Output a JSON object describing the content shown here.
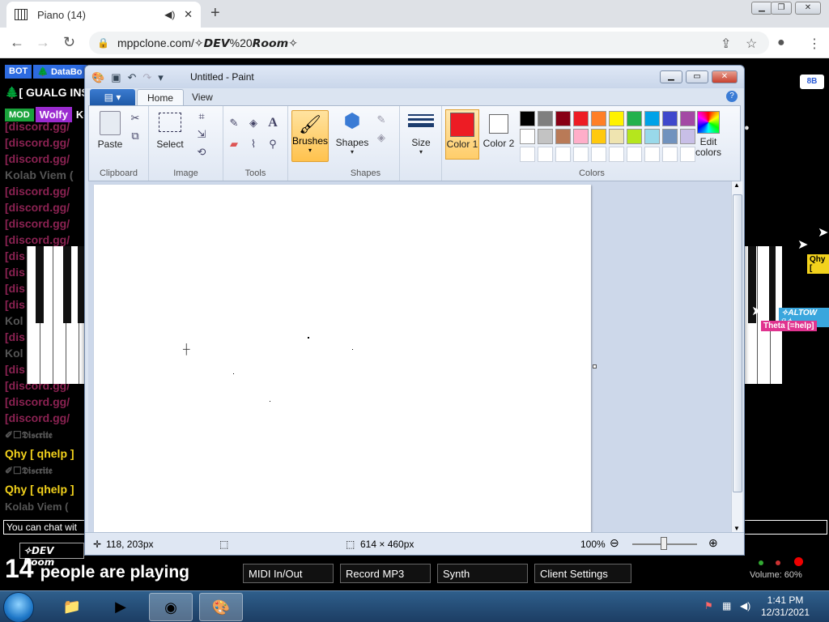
{
  "browser": {
    "tab_title": "Piano (14)",
    "url": "mppclone.com/✧𝘿𝙀𝙑%20𝙍𝙤𝙤𝙢✧"
  },
  "mpp": {
    "bot_badge": "BOT",
    "bot_name": "🌲 DataBo",
    "line2": "🌲[ GUALG INSI",
    "mod_badge": "MOD",
    "mod_name": "Wolfy",
    "mod_tail": "Ko",
    "discord_prefix": "[discord.gg/",
    "dis_short": "[dis",
    "kolab_short": "Kolab Viem (",
    "kol_short": "Kol",
    "discriter": "✐☐𝕯𝖎𝖘𝖈𝖗𝖎𝖙𝖊",
    "qhy": "Qhy [ qhelp ]",
    "chat_placeholder": "You can chat wit",
    "room_label": "✧𝘿𝙀𝙑 𝙍𝙤𝙤𝙢",
    "count_number": "14",
    "count_text": "people are playing",
    "btn_midi": "MIDI In/Out",
    "btn_record": "Record MP3",
    "btn_synth": "Synth",
    "btn_client": "Client Settings",
    "volume": "Volume: 60%",
    "cursor_qhy": "Qhy [",
    "cursor_theta": "Theta [=help]",
    "cursor_other": "✧ALTOW ÿ✧",
    "user_btn": "8B"
  },
  "paint": {
    "title": "Untitled - Paint",
    "tab_home": "Home",
    "tab_view": "View",
    "paste": "Paste",
    "select": "Select",
    "brushes": "Brushes",
    "shapes": "Shapes",
    "size": "Size",
    "color1": "Color 1",
    "color2": "Color 2",
    "edit_colors": "Edit colors",
    "group_clipboard": "Clipboard",
    "group_image": "Image",
    "group_tools": "Tools",
    "group_shapes": "Shapes",
    "group_colors": "Colors",
    "cursor_pos": "118, 203px",
    "canvas_size": "614 × 460px",
    "zoom": "100%",
    "color1_hex": "#ed1c24",
    "color2_hex": "#ffffff",
    "palette_row1": [
      "#000000",
      "#7f7f7f",
      "#880015",
      "#ed1c24",
      "#ff7f27",
      "#fff200",
      "#22b14c",
      "#00a2e8",
      "#3f48cc",
      "#a349a4"
    ],
    "palette_row2": [
      "#ffffff",
      "#c3c3c3",
      "#b97a57",
      "#ffaec9",
      "#ffc90e",
      "#efe4b0",
      "#b5e61d",
      "#99d9ea",
      "#7092be",
      "#c8bfe7"
    ]
  },
  "taskbar": {
    "time": "1:41 PM",
    "date": "12/31/2021"
  }
}
